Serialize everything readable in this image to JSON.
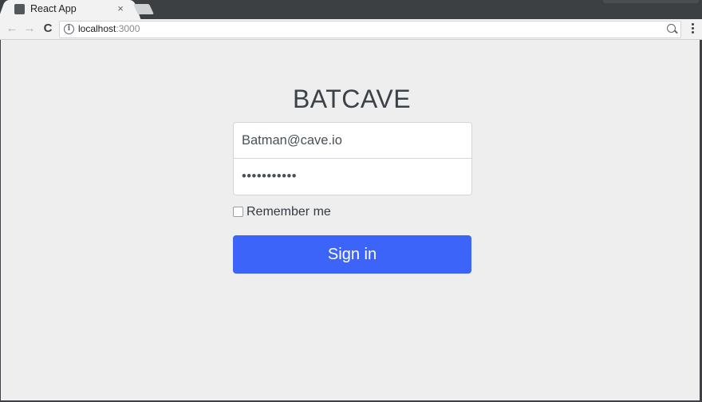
{
  "browser": {
    "tab_title": "React App",
    "tab_close": "×",
    "url_host": "localhost",
    "url_port": ":3000",
    "back_icon": "←",
    "forward_icon": "→",
    "reload_icon": "C",
    "info_icon": "i"
  },
  "login": {
    "heading": "BATCAVE",
    "email_value": "Batman@cave.io",
    "password_value": "•••••••••••",
    "remember_label": "Remember me",
    "remember_checked": false,
    "submit_label": "Sign in"
  },
  "colors": {
    "accent": "#3c64f8",
    "page_background": "#eeeeee",
    "heading": "#3b4147"
  }
}
